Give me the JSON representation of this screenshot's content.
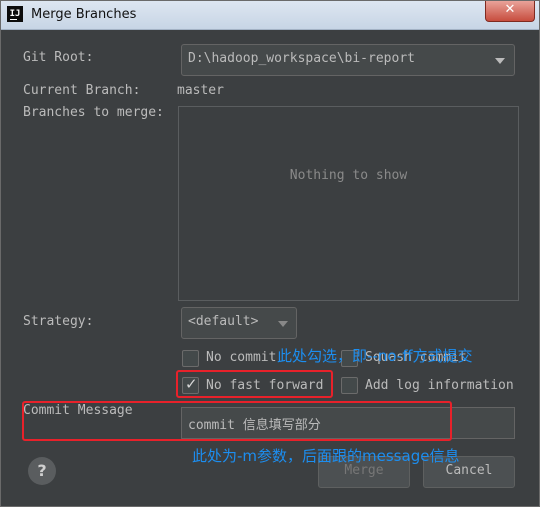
{
  "window": {
    "title": "Merge Branches",
    "app_icon": "IJ",
    "close_glyph": "✕"
  },
  "form": {
    "git_root_label": "Git Root:",
    "git_root_value": "D:\\hadoop_workspace\\bi-report",
    "current_branch_label": "Current Branch:",
    "current_branch_value": "master",
    "branches_label": "Branches to merge:",
    "branches_empty_text": "Nothing to show",
    "strategy_label": "Strategy:",
    "strategy_value": "<default>",
    "options": {
      "no_commit": {
        "label": "No commit",
        "checked": false
      },
      "squash_commit": {
        "label": "Squash commit",
        "checked": false
      },
      "no_fast_forward": {
        "label": "No fast forward",
        "checked": true
      },
      "add_log_information": {
        "label": "Add log information",
        "checked": false
      }
    },
    "commit_message_label": "Commit Message",
    "commit_message_value": "commit 信息填写部分"
  },
  "buttons": {
    "help": "?",
    "merge": "Merge",
    "cancel": "Cancel"
  },
  "annotations": {
    "note1": "此处勾选，即--no-ff方式提交",
    "note2": "此处为-m参数，后面跟的message信息"
  },
  "colors": {
    "annotation_text": "#1c8ef0",
    "annotation_box": "#e8212a",
    "background": "#3c3f41"
  }
}
